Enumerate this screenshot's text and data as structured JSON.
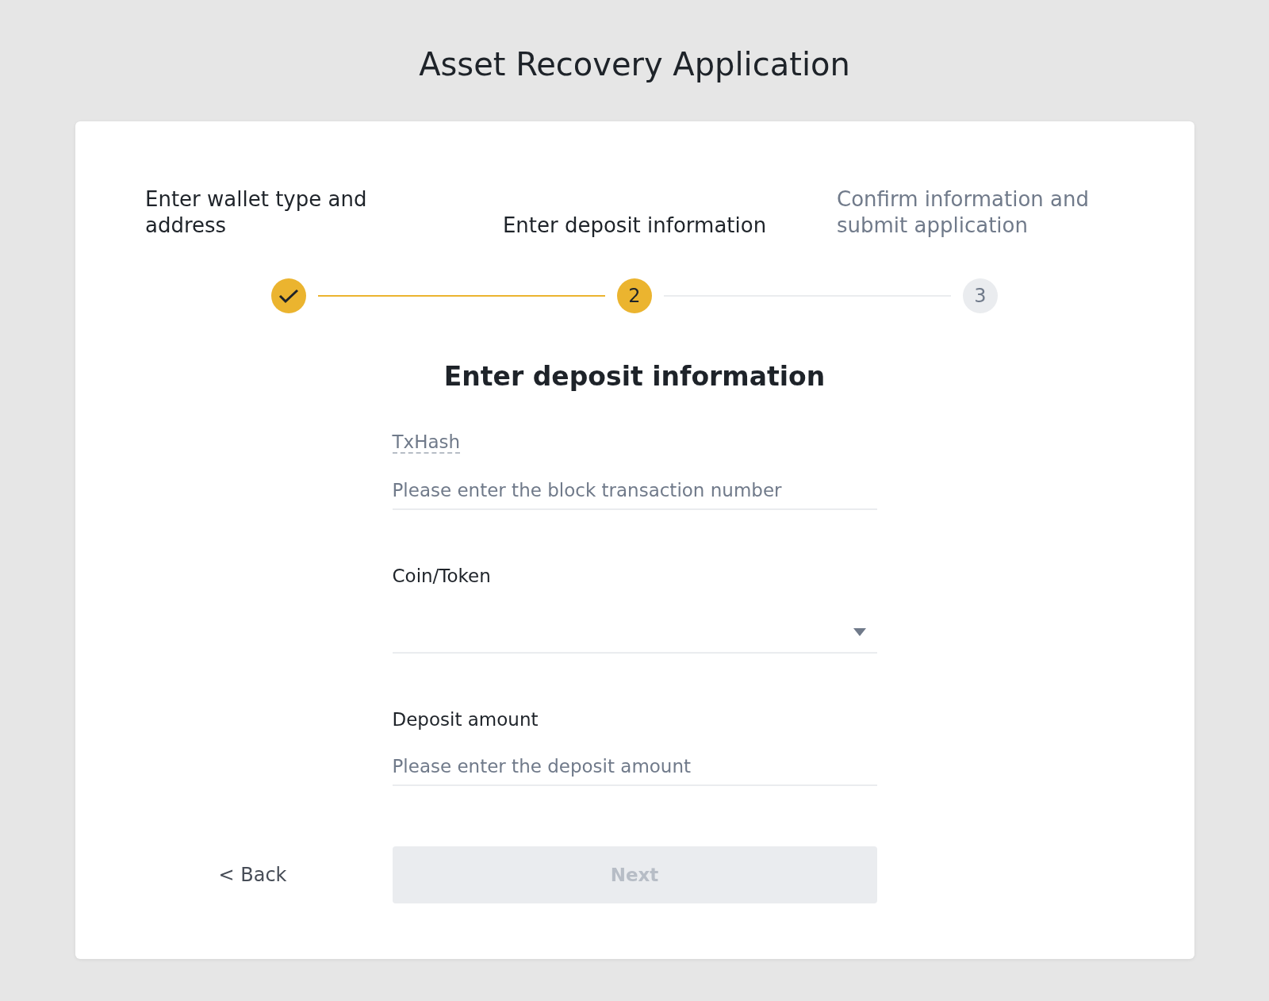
{
  "title": "Asset Recovery Application",
  "steps": [
    {
      "label": "Enter wallet type and address",
      "done": true
    },
    {
      "label": "Enter deposit information",
      "done": false,
      "selected": true,
      "number": "2"
    },
    {
      "label": "Confirm information and submit application",
      "done": false,
      "selected": false,
      "number": "3"
    }
  ],
  "form": {
    "heading": "Enter deposit information",
    "fields": [
      {
        "kind": "input",
        "label": "TxHash",
        "label_dashed": true,
        "placeholder": "Please enter the block transaction number"
      },
      {
        "kind": "select",
        "label": "Coin/Token",
        "label_dashed": false
      },
      {
        "kind": "input",
        "label": "Deposit amount",
        "label_dashed": false,
        "placeholder": "Please enter the deposit amount"
      }
    ]
  },
  "back": "< Back",
  "next": {
    "label": "Next",
    "disabled": true
  }
}
